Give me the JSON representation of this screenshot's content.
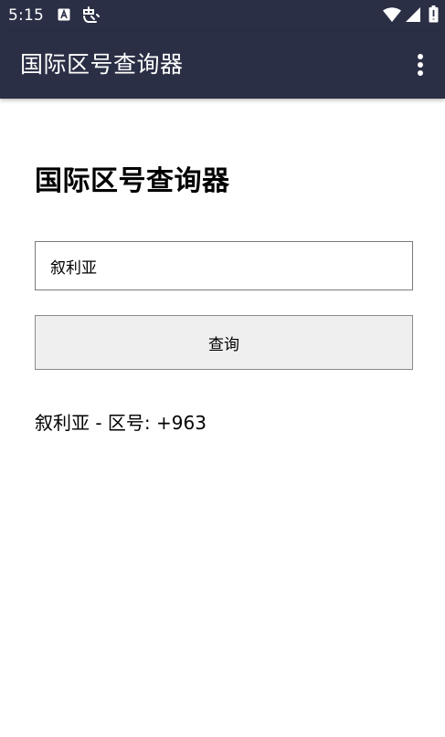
{
  "status_bar": {
    "time": "5:15",
    "icons": [
      "a-icon",
      "notification-icon",
      "wifi-icon",
      "signal-icon",
      "battery-icon"
    ]
  },
  "app_bar": {
    "title": "国际区号查询器",
    "menu_icon": "more-vert-icon"
  },
  "main": {
    "heading": "国际区号查询器",
    "country_input": {
      "value": "叙利亚"
    },
    "query_button_label": "查询",
    "result_text": "叙利亚 - 区号: +963"
  },
  "colors": {
    "app_bar_bg": "#2b2f45",
    "button_bg": "#efefef"
  }
}
